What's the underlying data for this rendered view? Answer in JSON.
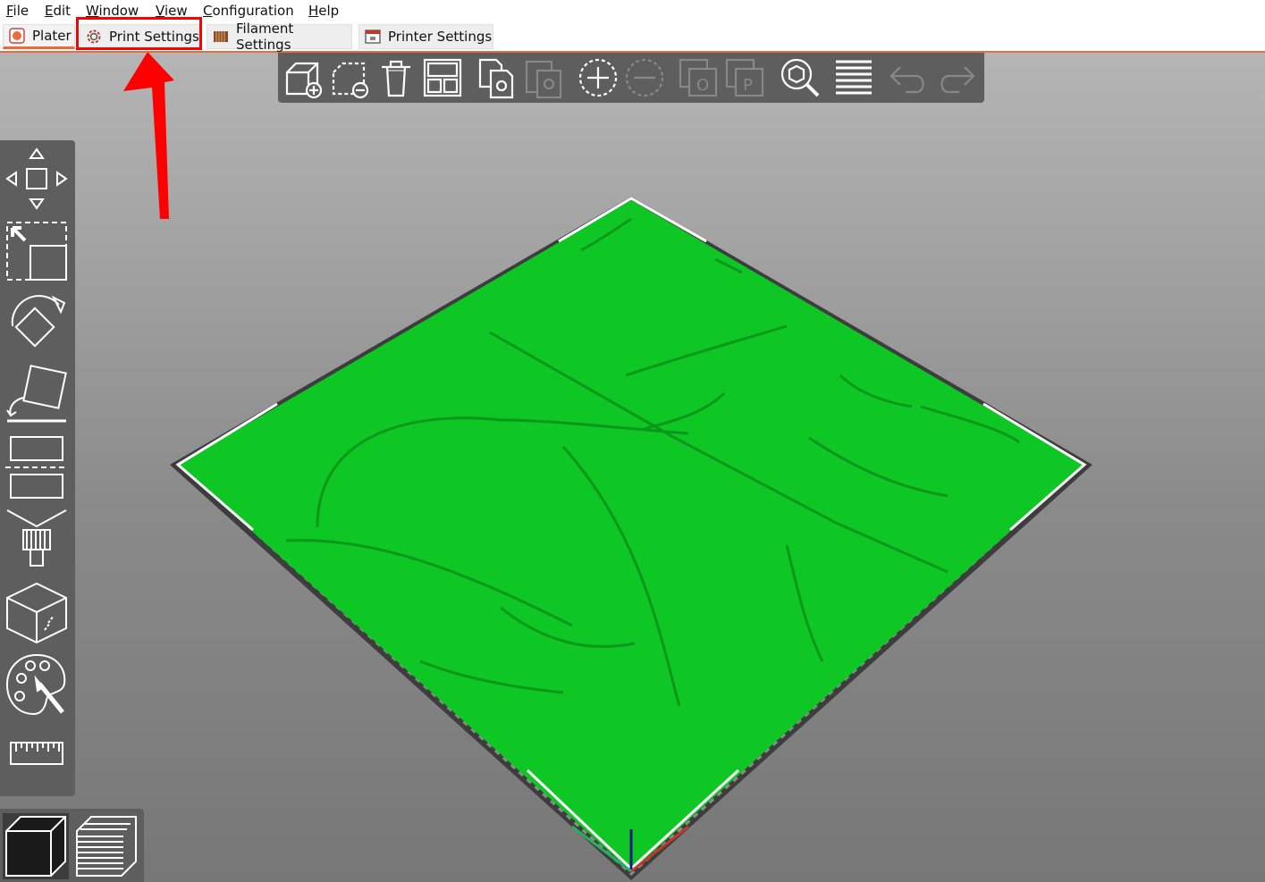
{
  "menu": {
    "items": [
      {
        "label": "File",
        "ul": "F",
        "rest": "ile"
      },
      {
        "label": "Edit",
        "ul": "E",
        "rest": "dit"
      },
      {
        "label": "Window",
        "ul": "W",
        "rest": "indow"
      },
      {
        "label": "View",
        "ul": "V",
        "rest": "iew"
      },
      {
        "label": "Configuration",
        "ul": "C",
        "rest": "onfiguration"
      },
      {
        "label": "Help",
        "ul": "H",
        "rest": "elp"
      }
    ]
  },
  "tabs": [
    {
      "label": "Plater",
      "icon": "plater-icon",
      "active": true
    },
    {
      "label": "Print Settings",
      "icon": "gear-icon",
      "active": false
    },
    {
      "label": "Filament Settings",
      "icon": "filament-spool-icon",
      "active": false
    },
    {
      "label": "Printer Settings",
      "icon": "printer-icon",
      "active": false
    }
  ],
  "annotation": {
    "highlight_color": "#ff0000",
    "highlighted_tab": "Print Settings"
  },
  "top_toolbar": {
    "buttons": [
      "add-object-icon",
      "delete-icon",
      "delete-all-icon",
      "arrange-icon",
      "copy-icon",
      "paste-icon",
      "add-instance-icon",
      "remove-instance-icon",
      "split-objects-icon",
      "split-parts-icon",
      "search-icon",
      "layers-editing-icon",
      "undo-icon",
      "redo-icon"
    ]
  },
  "left_toolbar": {
    "buttons": [
      "move-icon",
      "scale-icon",
      "rotate-icon",
      "place-on-face-icon",
      "cut-icon",
      "support-paint-icon",
      "seam-paint-icon",
      "color-paint-icon",
      "measure-icon"
    ]
  },
  "view_toolbar": {
    "buttons": [
      "3d-view-icon",
      "preview-layers-icon"
    ]
  },
  "colors": {
    "accent": "#ec6b3c",
    "model_green": "#0ec724",
    "toolbar_bg": "#5e5e5e"
  }
}
